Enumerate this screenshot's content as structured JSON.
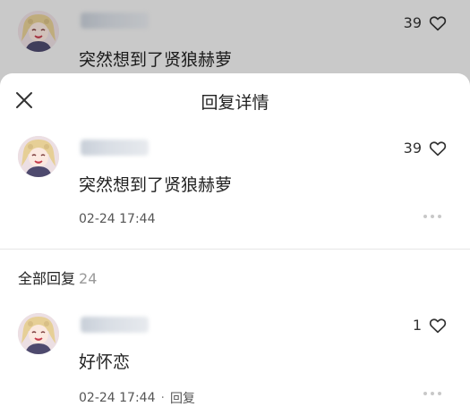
{
  "background_comment": {
    "text": "突然想到了贤狼赫萝",
    "likes": "39"
  },
  "sheet": {
    "title": "回复详情"
  },
  "main_comment": {
    "text": "突然想到了贤狼赫萝",
    "likes": "39",
    "timestamp": "02-24 17:44"
  },
  "replies_header": {
    "label": "全部回复",
    "count": "24"
  },
  "replies": [
    {
      "text": "好怀恋",
      "likes": "1",
      "timestamp": "02-24 17:44",
      "reply_label": "回复"
    }
  ],
  "icons": [
    "close-icon",
    "heart-icon",
    "more-icon"
  ],
  "colors": {
    "overlay": "#d2d2d2",
    "text_primary": "#222222",
    "text_secondary": "#555555",
    "count_muted": "#999999"
  }
}
